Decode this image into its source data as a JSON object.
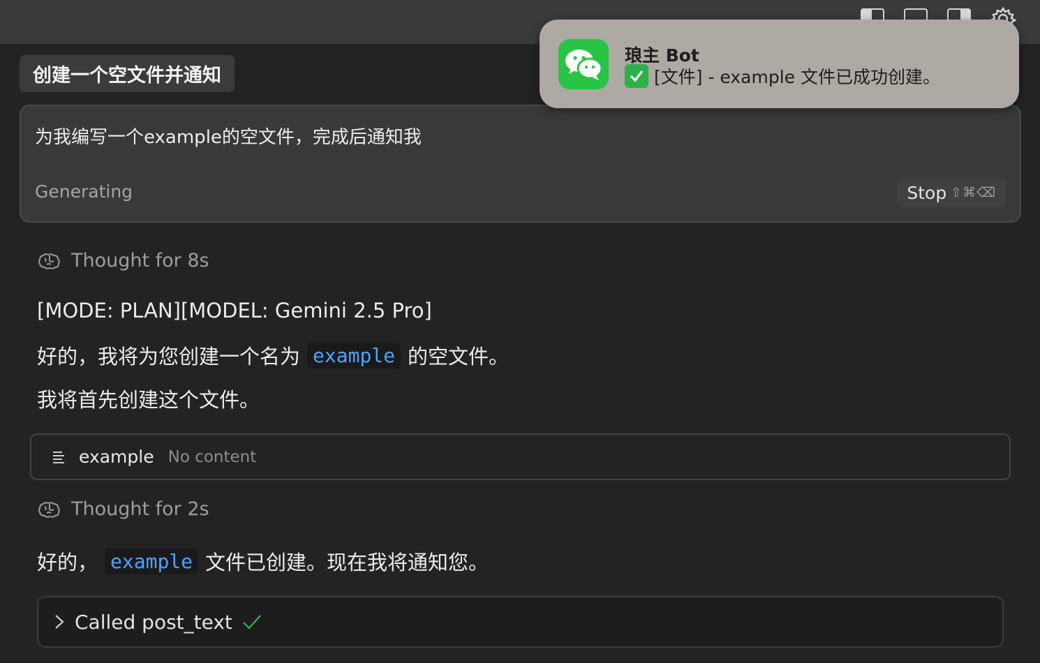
{
  "notification": {
    "app_icon": "wechat-icon",
    "title": "琅主 Bot",
    "body_icon": "check-mark-button-icon",
    "body": "[文件] - example 文件已成功创建。"
  },
  "header": {
    "icons": [
      "sidebar-left-icon",
      "layout-panel-icon",
      "sidebar-right-icon",
      "gear-icon"
    ]
  },
  "conversation": {
    "title": "创建一个空文件并通知",
    "prompt": "为我编写一个example的空文件，完成后通知我",
    "status": "Generating",
    "stop_label": "Stop",
    "stop_shortcut": "⇧⌘⌫"
  },
  "thoughts": [
    {
      "label": "Thought for 8s"
    },
    {
      "label": "Thought for 2s"
    }
  ],
  "messages": {
    "mode_line": "[MODE: PLAN][MODEL: Gemini 2.5 Pro]",
    "line1_pre": "好的，我将为您创建一个名为",
    "line1_code": "example",
    "line1_post": "的空文件。",
    "line2": "我将首先创建这个文件。",
    "line3_pre": "好的，",
    "line3_code": "example",
    "line3_post": "文件已创建。现在我将通知您。"
  },
  "file_card": {
    "icon": "text-lines-icon",
    "name": "example",
    "status": "No content"
  },
  "tool_call": {
    "label": "Called post_text",
    "status_icon": "checkmark-icon"
  },
  "colors": {
    "background": "#232323",
    "code_accent": "#4ea3ff",
    "success": "#3fae59",
    "wechat": "#28c445"
  }
}
